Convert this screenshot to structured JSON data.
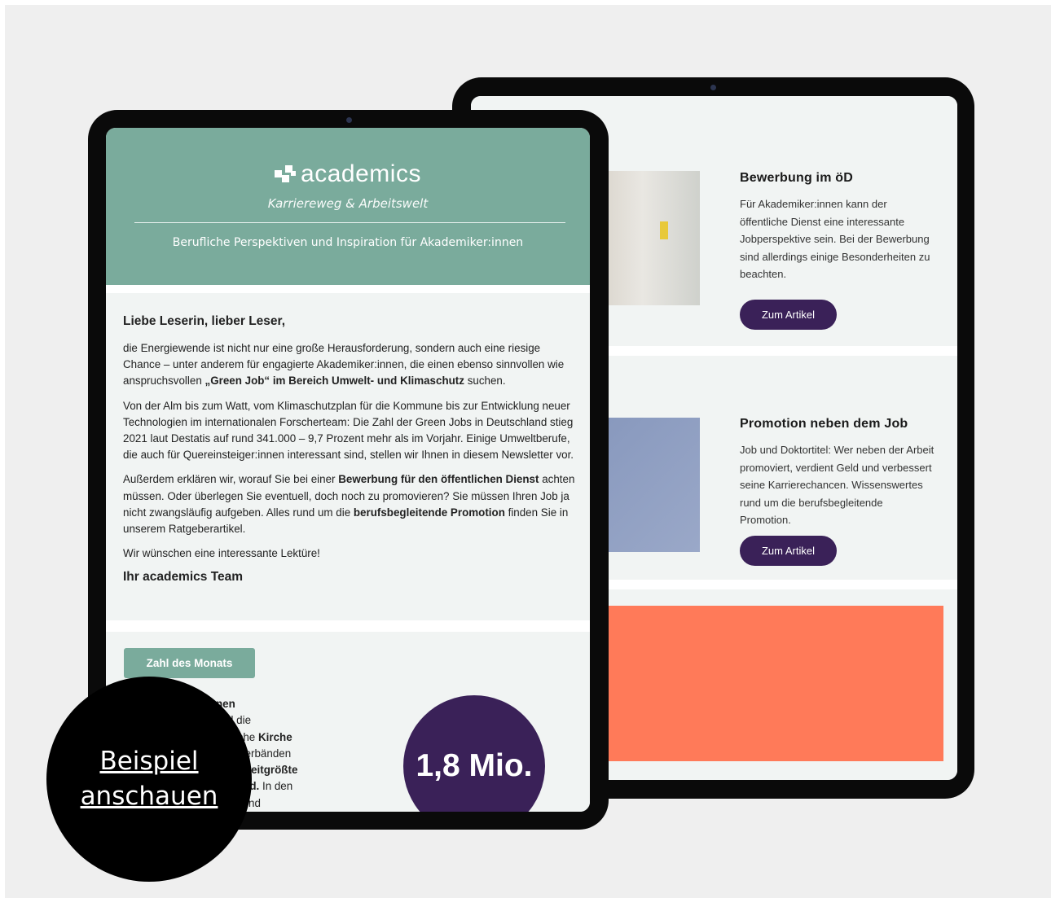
{
  "colors": {
    "background": "#efefef",
    "tablet": "#0a0a0a",
    "brand_green": "#7aab9c",
    "brand_purple": "#3a2158",
    "section_bg": "#f1f4f3",
    "orange": "#ff7a59"
  },
  "newsletter": {
    "logo_text": "academics",
    "tagline": "Karriereweg & Arbeitswelt",
    "subtitle": "Berufliche Perspektiven und Inspiration für Akademiker:innen",
    "greeting": "Liebe Leserin, lieber Leser,",
    "p1_a": "die Energiewende ist nicht nur eine große Herausforderung, sondern auch eine riesige Chance – unter anderem für engagierte Akademiker:innen, die einen ebenso sinnvollen wie anspruchsvollen ",
    "p1_bold": "„Green Job“ im Bereich Umwelt- und Klimaschutz",
    "p1_b": " suchen.",
    "p2": "Von der Alm bis zum Watt, vom Klimaschutzplan für die Kommune bis zur Entwicklung neuer Technologien im internationalen Forscherteam: Die Zahl der Green Jobs in Deutschland stieg 2021 laut Destatis auf rund 341.000 – 9,7 Prozent mehr als im Vorjahr. Einige Umweltberufe, die auch für Quereinsteiger:innen interessant sind, stellen wir Ihnen in diesem Newsletter vor.",
    "p3_a": "Außerdem erklären wir, worauf Sie bei einer ",
    "p3_bold1": "Bewerbung für den öffentlichen Dienst",
    "p3_b": " achten müssen. Oder überlegen Sie eventuell, doch noch zu promovieren? Sie müssen Ihren Job ja nicht zwangsläufig aufgeben. Alles rund um die ",
    "p3_bold2": "berufsbegleitende Promotion",
    "p3_c": " finden Sie in unserem Ratgeberartikel.",
    "p4": "Wir wünschen eine interessante Lektüre!",
    "signature": "Ihr academics Team",
    "zahl_label": "Zahl des Monats",
    "zahl_line1": "nen",
    "zahl_line2": "d die",
    "zahl_line3_a": "lische ",
    "zahl_line3_bold": "Kirche",
    "zahl_line4": "rtsverbänden",
    "zahl_line5_bold": "zweitgrößte",
    "zahl_line6_bold": "land.",
    "zahl_line6_b": " In den",
    "zahl_line7": "en und",
    "zahl_value": "1,8 Mio."
  },
  "articles": [
    {
      "title": "Bewerbung im öD",
      "text": "Für Akademiker:innen kann der öffentliche Dienst eine interessante Jobperspektive sein. Bei der Bewerbung sind allerdings einige Besonderheiten zu beachten.",
      "button": "Zum Artikel"
    },
    {
      "title": "Promotion neben dem Job",
      "text": "Job und Doktortitel: Wer neben der Arbeit promoviert, verdient Geld und verbessert seine Karrierechancen. Wissenswertes rund um die berufsbegleitende Promotion.",
      "button": "Zum Artikel"
    }
  ],
  "cta": {
    "line1": "Beispiel",
    "line2": "anschauen"
  }
}
